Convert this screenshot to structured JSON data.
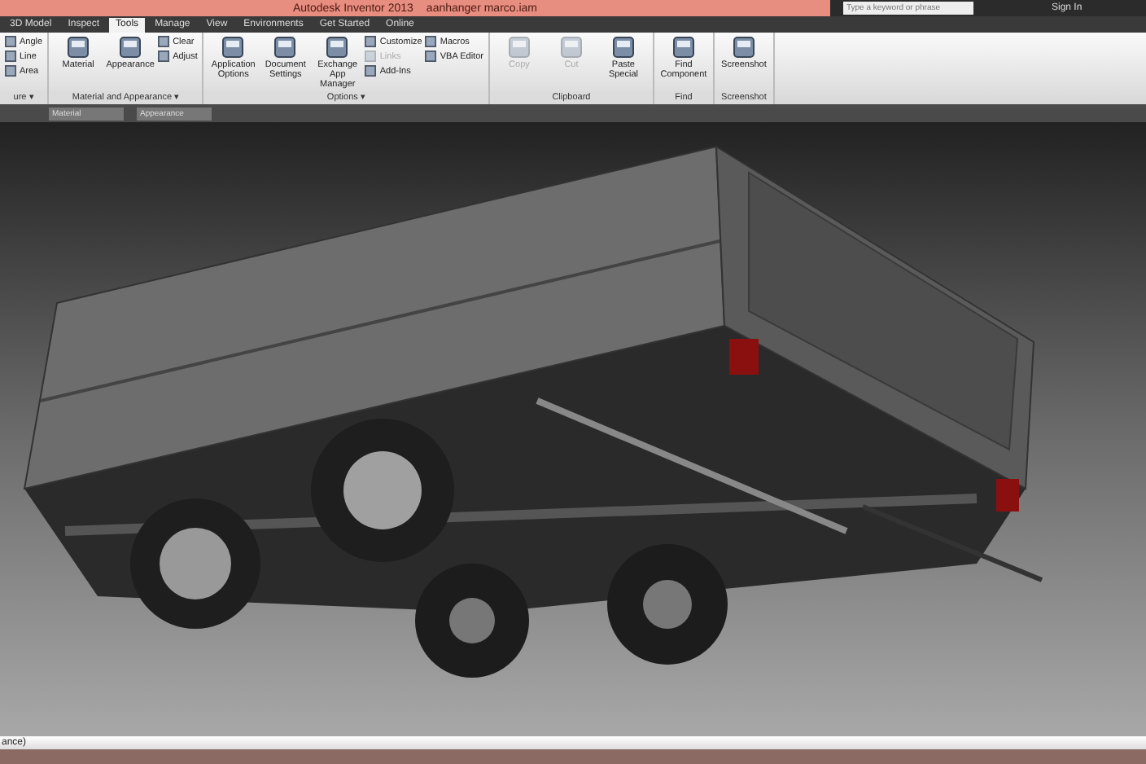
{
  "window": {
    "title": "Autodesk Inventor 2013",
    "document": "aanhanger marco.iam",
    "search": {
      "placeholder": "Type a keyword or phrase"
    },
    "sign_in": "Sign In"
  },
  "tabs": [
    {
      "label": "3D Model",
      "selected": false
    },
    {
      "label": "Inspect",
      "selected": false
    },
    {
      "label": "Tools",
      "selected": true
    },
    {
      "label": "Manage",
      "selected": false
    },
    {
      "label": "View",
      "selected": false
    },
    {
      "label": "Environments",
      "selected": false
    },
    {
      "label": "Get Started",
      "selected": false
    },
    {
      "label": "Online",
      "selected": false
    }
  ],
  "ribbon": [
    {
      "title": "ure ▾",
      "items": [
        {
          "label": "Angle",
          "kind": "small",
          "disabled": false
        },
        {
          "label": "Line",
          "kind": "small",
          "disabled": false
        },
        {
          "label": "Area",
          "kind": "small",
          "disabled": false
        }
      ]
    },
    {
      "title": "Material and Appearance ▾",
      "items": [
        {
          "label": "Material",
          "kind": "large",
          "disabled": false
        },
        {
          "label": "Appearance",
          "kind": "large",
          "disabled": false
        },
        {
          "label": "Clear",
          "kind": "small",
          "disabled": false
        },
        {
          "label": "Adjust",
          "kind": "small",
          "disabled": false
        }
      ]
    },
    {
      "title": "Options ▾",
      "items": [
        {
          "label": "Application Options",
          "kind": "large",
          "disabled": false
        },
        {
          "label": "Document Settings",
          "kind": "large",
          "disabled": false
        },
        {
          "label": "Exchange App Manager",
          "kind": "large",
          "disabled": false
        },
        {
          "label": "Customize",
          "kind": "small",
          "disabled": false
        },
        {
          "label": "Links",
          "kind": "small",
          "disabled": true
        },
        {
          "label": "Add-Ins",
          "kind": "small",
          "disabled": false
        },
        {
          "label": "Macros",
          "kind": "small",
          "disabled": false
        },
        {
          "label": "VBA Editor",
          "kind": "small",
          "disabled": false
        }
      ]
    },
    {
      "title": "Clipboard",
      "items": [
        {
          "label": "Copy",
          "kind": "large",
          "disabled": true
        },
        {
          "label": "Cut",
          "kind": "large",
          "disabled": true
        },
        {
          "label": "Paste Special",
          "kind": "large",
          "disabled": false
        }
      ]
    },
    {
      "title": "Find",
      "items": [
        {
          "label": "Find Component",
          "kind": "large",
          "disabled": false
        }
      ]
    },
    {
      "title": "Screenshot",
      "items": [
        {
          "label": "Screenshot",
          "kind": "large",
          "disabled": false
        }
      ]
    }
  ],
  "quick_bar": {
    "material": {
      "placeholder": "Material"
    },
    "appearance": {
      "placeholder": "Appearance"
    }
  },
  "status_bar": {
    "text": "ance)"
  }
}
